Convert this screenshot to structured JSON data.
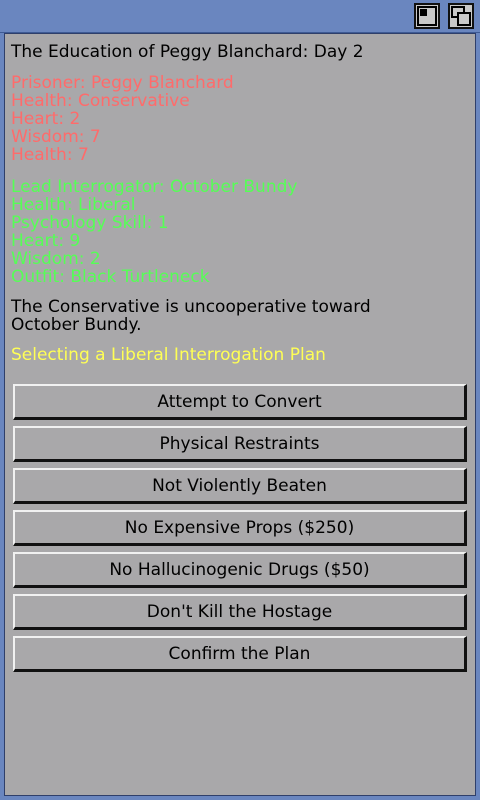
{
  "title": "The Education of Peggy Blanchard: Day 2",
  "prisoner": [
    "Prisoner: Peggy Blanchard",
    "Health: Conservative",
    "Heart: 2",
    "Wisdom: 7",
    "Health: 7"
  ],
  "interrogator": [
    "Lead Interrogator: October Bundy",
    "Health: Liberal",
    "Psychology Skill: 1",
    "Heart: 9",
    "Wisdom: 2",
    "Outfit: Black Turtleneck"
  ],
  "narration": "The Conservative is uncooperative toward October Bundy.",
  "prompt": "Selecting a Liberal Interrogation Plan",
  "options": [
    "Attempt to Convert",
    "Physical Restraints",
    "Not Violently Beaten",
    "No Expensive Props ($250)",
    "No Hallucinogenic Drugs ($50)",
    "Don't Kill the Hostage",
    "Confirm the Plan"
  ]
}
